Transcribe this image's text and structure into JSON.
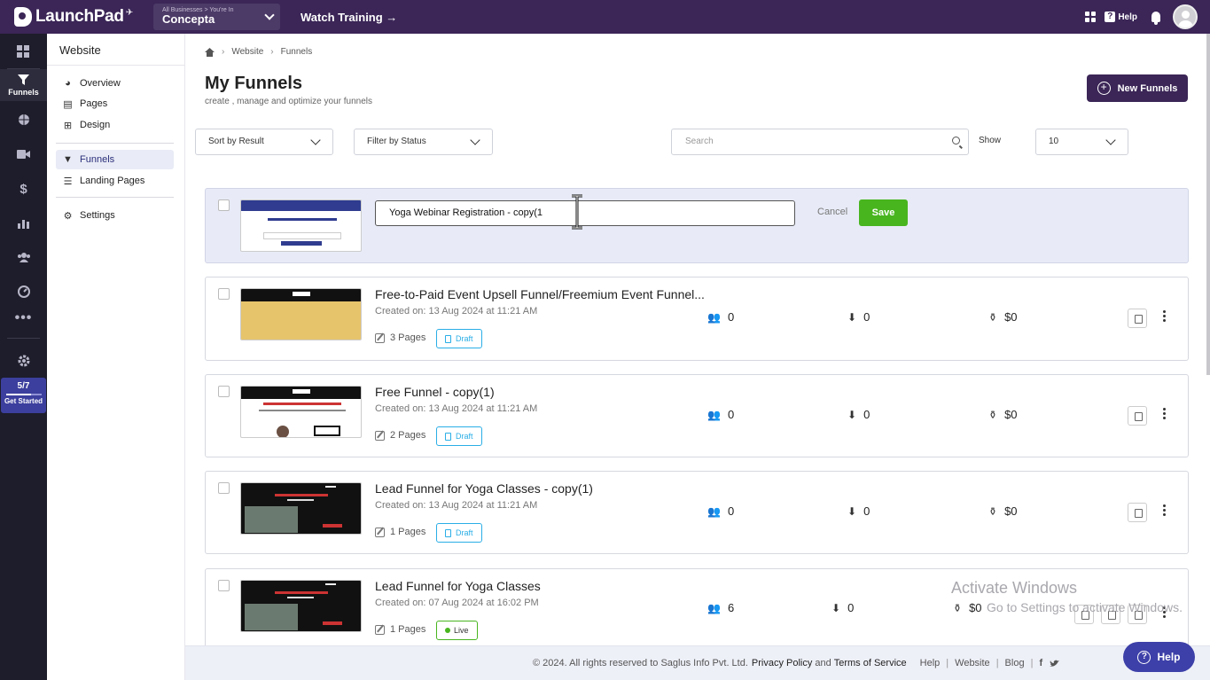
{
  "topbar": {
    "logo_text": "LaunchPad",
    "business_label": "All Businesses > You're In",
    "business_name": "Concepta",
    "watch_training": "Watch Training →",
    "help_label": "Help"
  },
  "rail": {
    "active_label": "Funnels",
    "progress_text": "5/7",
    "progress_value": 0.714,
    "get_started": "Get Started"
  },
  "sidebar": {
    "title": "Website",
    "items": [
      {
        "label": "Overview"
      },
      {
        "label": "Pages"
      },
      {
        "label": "Design"
      },
      {
        "label": "Funnels"
      },
      {
        "label": "Landing Pages"
      },
      {
        "label": "Settings"
      }
    ]
  },
  "breadcrumb": {
    "home": "home-icon",
    "items": [
      "Website",
      "Funnels"
    ]
  },
  "page": {
    "title": "My Funnels",
    "subtitle": "create , manage and optimize your funnels",
    "new_button": "New Funnels"
  },
  "filters": {
    "sort": "Sort by Result",
    "status": "Filter by Status",
    "search_placeholder": "Search",
    "show_label": "Show",
    "show_value": "10"
  },
  "editing": {
    "input_value": "Yoga Webinar Registration - copy(1",
    "cancel": "Cancel",
    "save": "Save"
  },
  "funnels": [
    {
      "name": "Free-to-Paid Event Upsell Funnel/Freemium Event Funnel...",
      "created": "Created on: 13 Aug 2024 at 11:21 AM",
      "pages": "3 Pages",
      "status": "Draft",
      "visitors": "0",
      "conversions": "0",
      "revenue": "$0"
    },
    {
      "name": "Free Funnel - copy(1)",
      "created": "Created on: 13 Aug 2024 at 11:21 AM",
      "pages": "2 Pages",
      "status": "Draft",
      "visitors": "0",
      "conversions": "0",
      "revenue": "$0"
    },
    {
      "name": "Lead Funnel for Yoga Classes - copy(1)",
      "created": "Created on: 13 Aug 2024 at 11:21 AM",
      "pages": "1 Pages",
      "status": "Draft",
      "visitors": "0",
      "conversions": "0",
      "revenue": "$0"
    },
    {
      "name": "Lead Funnel for Yoga Classes",
      "created": "Created on: 07 Aug 2024 at 16:02 PM",
      "pages": "1 Pages",
      "status": "Live",
      "visitors": "6",
      "conversions": "0",
      "revenue": "$0"
    }
  ],
  "footer": {
    "copyright": "© 2024. All rights reserved to Saglus Info Pvt. Ltd.",
    "privacy": "Privacy Policy",
    "and": "and",
    "terms": "Terms of Service",
    "help": "Help",
    "website": "Website",
    "blog": "Blog",
    "facebook": "f"
  },
  "help_float": "Help",
  "watermark": {
    "line1": "Activate Windows",
    "line2": "Go to Settings to activate Windows."
  }
}
